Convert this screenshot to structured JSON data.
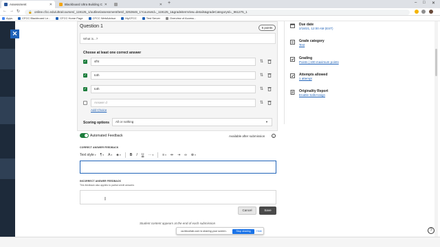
{
  "browser": {
    "tabs": [
      {
        "label": "Assessment",
        "active": true,
        "color": "#2b579a"
      },
      {
        "label": "Blackboard Ultra Building Cours",
        "active": false,
        "color": "#f2a413"
      },
      {
        "label": "",
        "active": false,
        "color": "#9e9e9e"
      }
    ],
    "new_tab_icon": "plus-icon",
    "url": "online.cfcc.edu/ultra/courses/_119125_1/outline/assessment/test/_3253646_1?courseId=_119125_1&gradeitemView=details&gradeCategoryId=_961275_1",
    "bookmarks": [
      {
        "label": "Apps",
        "color": "#4285f4"
      },
      {
        "label": "CFCC Blackboard Le...",
        "color": "#1f62b8"
      },
      {
        "label": "CFCC Home Page",
        "color": "#1f62b8"
      },
      {
        "label": "CFCC WebAdvisor",
        "color": "#1f62b8"
      },
      {
        "label": "MyCFCC",
        "color": "#1f62b8"
      },
      {
        "label": "Test Server",
        "color": "#1f62b8"
      },
      {
        "label": "Overview of Access...",
        "color": "#888888"
      }
    ]
  },
  "question": {
    "title": "Question 1",
    "points": "5 points",
    "text": "What is...?",
    "choose_label": "Choose at least one correct answer",
    "answers": [
      {
        "text": "sfht",
        "correct": true,
        "placeholder": false
      },
      {
        "text": "toth",
        "correct": true,
        "placeholder": false
      },
      {
        "text": "toth",
        "correct": true,
        "placeholder": false
      },
      {
        "text": "Answer d",
        "correct": false,
        "placeholder": true
      }
    ],
    "add_choice": "Add Choice",
    "scoring_label": "Scoring options",
    "scoring_value": "All or nothing"
  },
  "feedback": {
    "toggle_label": "Automated Feedback",
    "availability": "Available after submission",
    "correct_caption": "CORRECT ANSWER FEEDBACK",
    "incorrect_caption": "INCORRECT ANSWER FEEDBACK",
    "incorrect_note": "This feedback also applies to partial credit answers",
    "text_style": "Text style",
    "cancel": "Cancel",
    "save": "Save",
    "student_note": "Student content appears at the end of each submission"
  },
  "settings": [
    {
      "title": "Due date",
      "value": "2/18/21, 12:00 AM (EST)",
      "link": false,
      "icon": "calendar-icon"
    },
    {
      "title": "Grade category",
      "value": "Test",
      "link": true,
      "icon": "grade-category-icon"
    },
    {
      "title": "Grading",
      "value": "Points | 100 maximum points",
      "link": true,
      "icon": "grading-icon"
    },
    {
      "title": "Attempts allowed",
      "value": "1 attempt",
      "link": true,
      "icon": "attempts-icon"
    },
    {
      "title": "Originality Report",
      "value": "Enable SafeAssign",
      "link": true,
      "icon": "originality-icon"
    }
  ],
  "share": {
    "text": "ca.bbcollab.com is sharing your screen.",
    "stop": "Stop sharing",
    "hide": "Hide"
  },
  "colors": {
    "accent": "#1f62b8",
    "correct": "#1c7d3c",
    "dark_nav": "#1d2a3a"
  }
}
